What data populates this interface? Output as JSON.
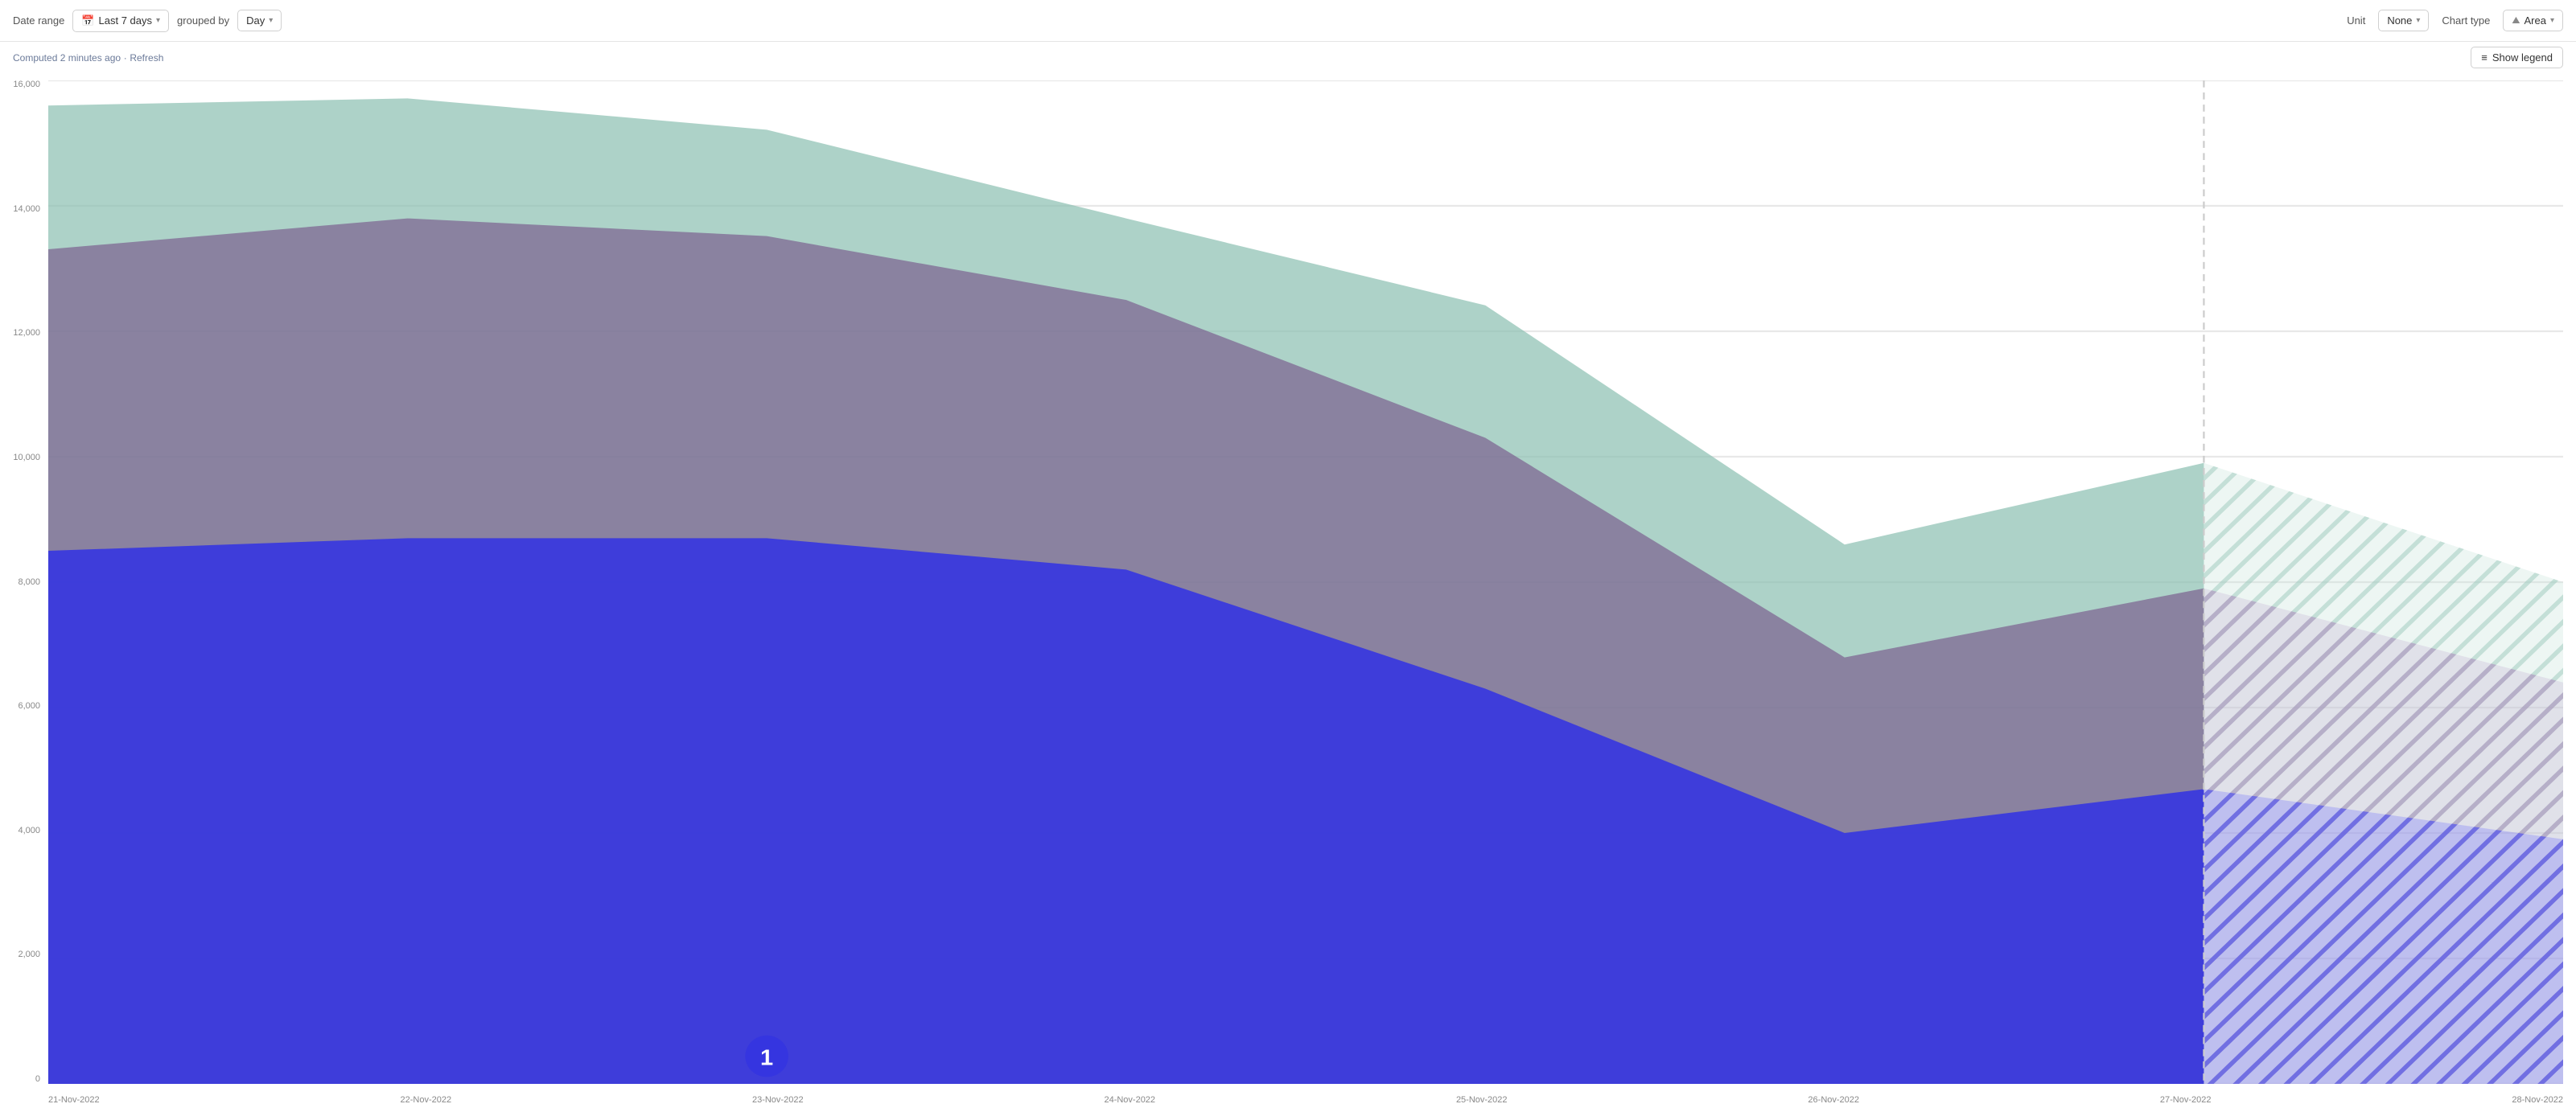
{
  "toolbar": {
    "date_range_label": "Date range",
    "date_range_value": "Last 7 days",
    "grouped_by_label": "grouped by",
    "grouped_by_value": "Day",
    "unit_label": "Unit",
    "unit_value": "None",
    "chart_type_label": "Chart type",
    "chart_type_value": "Area"
  },
  "subbar": {
    "computed_text": "Computed 2 minutes ago",
    "dot": "·",
    "refresh_label": "Refresh",
    "show_legend_label": "Show legend"
  },
  "y_axis": {
    "labels": [
      "16,000",
      "14,000",
      "12,000",
      "10,000",
      "8,000",
      "6,000",
      "4,000",
      "2,000",
      "0"
    ]
  },
  "x_axis": {
    "labels": [
      "21-Nov-2022",
      "22-Nov-2022",
      "23-Nov-2022",
      "24-Nov-2022",
      "25-Nov-2022",
      "26-Nov-2022",
      "27-Nov-2022",
      "28-Nov-2022"
    ]
  },
  "chart": {
    "colors": {
      "teal": "#8abfb0",
      "purple": "#8b6b9e",
      "blue": "#3535e0",
      "teal_solid": "#7ab5a5",
      "purple_solid": "#7a5f8e"
    }
  },
  "annotation": {
    "label": "1"
  }
}
